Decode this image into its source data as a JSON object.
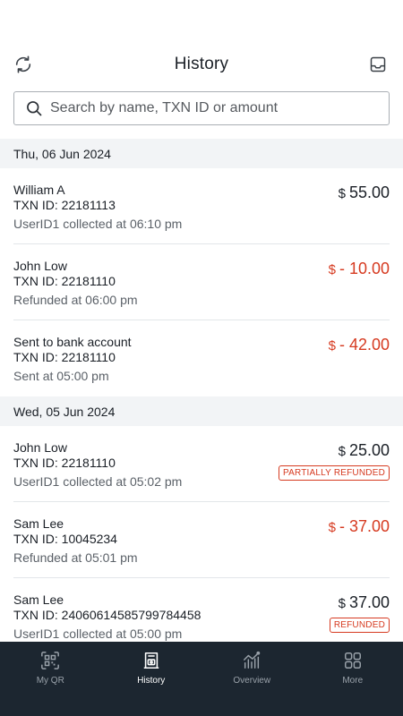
{
  "header": {
    "title": "History",
    "refresh_icon": "refresh-icon",
    "inbox_icon": "inbox-icon"
  },
  "search": {
    "placeholder": "Search by name, TXN ID or amount",
    "value": ""
  },
  "groups": [
    {
      "date": "Thu, 06 Jun 2024",
      "transactions": [
        {
          "name": "William A",
          "txn_id": "TXN ID: 22181113",
          "status": "UserID1 collected at 06:10 pm",
          "currency": "$",
          "amount": "55.00",
          "negative": false,
          "badge": ""
        },
        {
          "name": "John Low",
          "txn_id": "TXN ID: 22181110",
          "status": "Refunded at 06:00 pm",
          "currency": "$",
          "amount": "- 10.00",
          "negative": true,
          "badge": ""
        },
        {
          "name": "Sent to bank account",
          "txn_id": "TXN ID: 22181110",
          "status": "Sent at 05:00 pm",
          "currency": "$",
          "amount": "- 42.00",
          "negative": true,
          "badge": ""
        }
      ]
    },
    {
      "date": "Wed, 05 Jun 2024",
      "transactions": [
        {
          "name": "John Low",
          "txn_id": "TXN ID: 22181110",
          "status": "UserID1 collected at 05:02 pm",
          "currency": "$",
          "amount": "25.00",
          "negative": false,
          "badge": "PARTIALLY REFUNDED"
        },
        {
          "name": "Sam Lee",
          "txn_id": "TXN ID: 10045234",
          "status": "Refunded at 05:01 pm",
          "currency": "$",
          "amount": "- 37.00",
          "negative": true,
          "badge": ""
        },
        {
          "name": "Sam Lee",
          "txn_id": "TXN ID: 24060614585799784458",
          "status": "UserID1 collected at 05:00 pm",
          "currency": "$",
          "amount": "37.00",
          "negative": false,
          "badge": "REFUNDED"
        }
      ]
    }
  ],
  "tabs": [
    {
      "label": "My QR",
      "icon": "qr-code-icon",
      "active": false
    },
    {
      "label": "History",
      "icon": "receipt-icon",
      "active": true
    },
    {
      "label": "Overview",
      "icon": "chart-icon",
      "active": false
    },
    {
      "label": "More",
      "icon": "grid-icon",
      "active": false
    }
  ],
  "colors": {
    "negative": "#d63a20",
    "tabbar_bg": "#1c2630",
    "date_header_bg": "#f2f4f6"
  }
}
